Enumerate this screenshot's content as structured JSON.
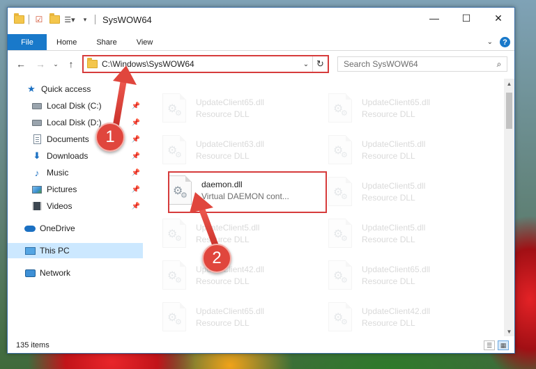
{
  "window": {
    "title": "SysWOW64",
    "controls": {
      "minimize": "—",
      "maximize": "☐",
      "close": "✕"
    }
  },
  "ribbon": {
    "tabs": [
      "File",
      "Home",
      "Share",
      "View"
    ]
  },
  "navigation": {
    "address": "C:\\Windows\\SysWOW64",
    "search_placeholder": "Search SysWOW64"
  },
  "sidebar": {
    "items": [
      {
        "label": "Quick access",
        "icon": "star-icon",
        "pinned": false
      },
      {
        "label": "Local Disk (C:)",
        "icon": "disk-icon",
        "pinned": true
      },
      {
        "label": "Local Disk (D:)",
        "icon": "disk-icon",
        "pinned": true
      },
      {
        "label": "Documents",
        "icon": "document-icon",
        "pinned": true
      },
      {
        "label": "Downloads",
        "icon": "download-icon",
        "pinned": true
      },
      {
        "label": "Music",
        "icon": "music-icon",
        "pinned": true
      },
      {
        "label": "Pictures",
        "icon": "pictures-icon",
        "pinned": true
      },
      {
        "label": "Videos",
        "icon": "videos-icon",
        "pinned": true
      },
      {
        "label": "OneDrive",
        "icon": "cloud-icon",
        "pinned": false
      },
      {
        "label": "This PC",
        "icon": "computer-icon",
        "pinned": false,
        "selected": true
      },
      {
        "label": "Network",
        "icon": "network-icon",
        "pinned": false
      }
    ]
  },
  "files": [
    {
      "name": "UpdateClient65.dll",
      "type": "Resource DLL",
      "faded": true
    },
    {
      "name": "UpdateClient65.dll",
      "type": "Resource DLL",
      "faded": true
    },
    {
      "name": "UpdateClient63.dll",
      "type": "Resource DLL",
      "faded": true
    },
    {
      "name": "UpdateClient5.dll",
      "type": "Resource DLL",
      "faded": true
    },
    {
      "name": "daemon.dll",
      "type": "Virtual DAEMON cont...",
      "faded": false
    },
    {
      "name": "UpdateClient5.dll",
      "type": "Resource DLL",
      "faded": true
    },
    {
      "name": "UpdateClient5.dll",
      "type": "Resource DLL",
      "faded": true
    },
    {
      "name": "UpdateClient5.dll",
      "type": "Resource DLL",
      "faded": true
    },
    {
      "name": "UpdateClient42.dll",
      "type": "Resource DLL",
      "faded": true
    },
    {
      "name": "UpdateClient65.dll",
      "type": "Resource DLL",
      "faded": true
    },
    {
      "name": "UpdateClient65.dll",
      "type": "Resource DLL",
      "faded": true
    },
    {
      "name": "UpdateClient42.dll",
      "type": "Resource DLL",
      "faded": true
    }
  ],
  "status": {
    "item_count": "135 items"
  },
  "annotations": {
    "step1": "1",
    "step2": "2",
    "color": "#d63b3b"
  }
}
